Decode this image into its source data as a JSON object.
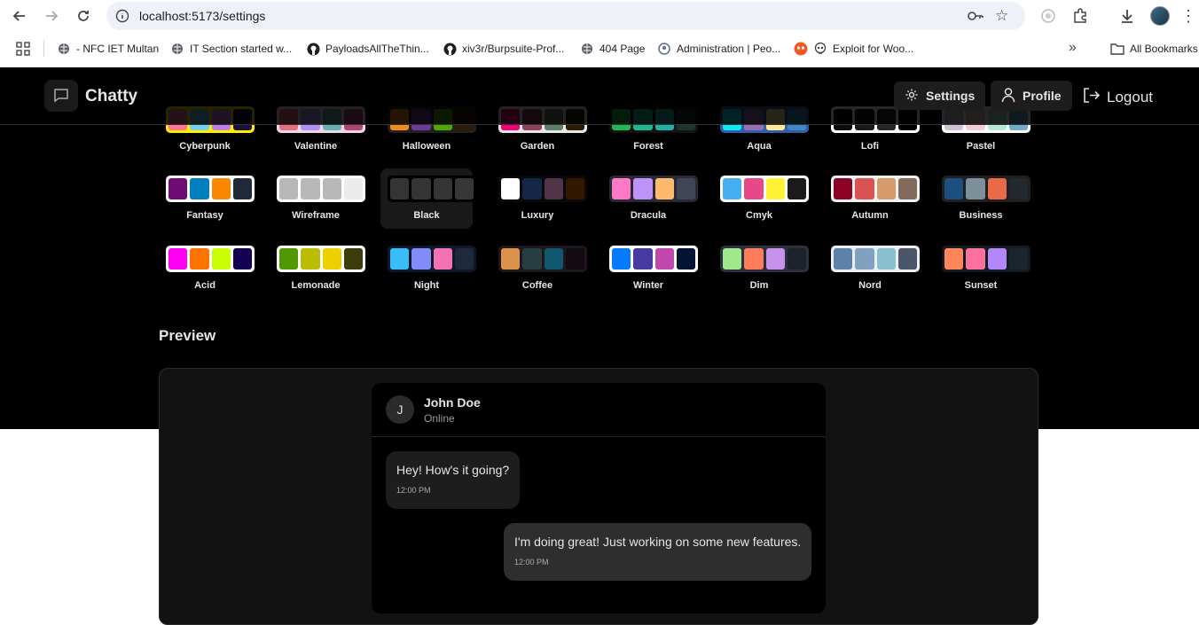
{
  "browser": {
    "url": "localhost:5173/settings",
    "bookmarks": [
      {
        "label": "- NFC IET Multan",
        "icon": "globe-icon"
      },
      {
        "label": "IT Section started w...",
        "icon": "globe-icon"
      },
      {
        "label": "PayloadsAllTheThin...",
        "icon": "github-icon"
      },
      {
        "label": "xiv3r/Burpsuite-Prof...",
        "icon": "github-icon"
      },
      {
        "label": "404 Page",
        "icon": "globe-icon"
      },
      {
        "label": "Administration | Peo...",
        "icon": "people-icon"
      },
      {
        "label": "Exploit for Woo...",
        "icon": "skull-icon"
      }
    ],
    "all_bookmarks": "All Bookmarks",
    "overflow": "»"
  },
  "header": {
    "brand": "Chatty",
    "settings_label": "Settings",
    "profile_label": "Profile",
    "logout_label": "Logout"
  },
  "themes": [
    {
      "name": "Cyberpunk",
      "colors": [
        "#ff7598",
        "#75d1f0",
        "#c07eec",
        "#1a103d"
      ],
      "box": "#ffee00"
    },
    {
      "name": "Valentine",
      "colors": [
        "#e96d7b",
        "#a991f7",
        "#66b1b3",
        "#af4670"
      ],
      "box": "#f0d6e8"
    },
    {
      "name": "Halloween",
      "colors": [
        "#f28c18",
        "#6d3a9c",
        "#51a800",
        "#2f1b05"
      ],
      "box": "#212121"
    },
    {
      "name": "Garden",
      "colors": [
        "#f40076",
        "#8e4162",
        "#5c7f67",
        "#291e00"
      ],
      "box": "#e9e7e7"
    },
    {
      "name": "Forest",
      "colors": [
        "#1eb854",
        "#1db990",
        "#1fb2a6",
        "#19362d"
      ],
      "box": "#171212"
    },
    {
      "name": "Aqua",
      "colors": [
        "#09ecf3",
        "#966fb3",
        "#ffe999",
        "#3b8ac4"
      ],
      "box": "#345da7"
    },
    {
      "name": "Lofi",
      "colors": [
        "#0d0d0d",
        "#1a1919",
        "#262626",
        "#000000"
      ],
      "box": "#ffffff"
    },
    {
      "name": "Pastel",
      "colors": [
        "#d1c1d7",
        "#f6cbd1",
        "#b4e9d6",
        "#70acc7"
      ],
      "box": "#ffffff"
    },
    {
      "name": "Fantasy",
      "colors": [
        "#6e0b75",
        "#007ebd",
        "#f88800",
        "#1f2937"
      ],
      "box": "#ffffff"
    },
    {
      "name": "Wireframe",
      "colors": [
        "#b8b8b8",
        "#b8b8b8",
        "#b8b8b8",
        "#ebebeb"
      ],
      "box": "#ffffff"
    },
    {
      "name": "Black",
      "colors": [
        "#343434",
        "#343434",
        "#343434",
        "#373737"
      ],
      "box": "#000000"
    },
    {
      "name": "Luxury",
      "colors": [
        "#ffffff",
        "#152747",
        "#513448",
        "#331800"
      ],
      "box": "#09090b"
    },
    {
      "name": "Dracula",
      "colors": [
        "#ff79c6",
        "#bd93f9",
        "#ffb86c",
        "#414558"
      ],
      "box": "#282a36"
    },
    {
      "name": "Cmyk",
      "colors": [
        "#45aeee",
        "#e8488a",
        "#fff232",
        "#1a1a1a"
      ],
      "box": "#ffffff"
    },
    {
      "name": "Autumn",
      "colors": [
        "#8c0327",
        "#d85251",
        "#d59b6a",
        "#826a5c"
      ],
      "box": "#f1f1f1"
    },
    {
      "name": "Business",
      "colors": [
        "#1c4e80",
        "#7c909a",
        "#ea6947",
        "#23282e"
      ],
      "box": "#202020"
    },
    {
      "name": "Acid",
      "colors": [
        "#ff00f4",
        "#ff7400",
        "#cbfd03",
        "#140152"
      ],
      "box": "#ffffff"
    },
    {
      "name": "Lemonade",
      "colors": [
        "#519903",
        "#bcbc02",
        "#edd000",
        "#3d3c0c"
      ],
      "box": "#ffffff"
    },
    {
      "name": "Night",
      "colors": [
        "#38bdf8",
        "#818cf8",
        "#f471b5",
        "#1e293b"
      ],
      "box": "#0f172a"
    },
    {
      "name": "Coffee",
      "colors": [
        "#db924b",
        "#263e3f",
        "#10576d",
        "#120c12"
      ],
      "box": "#20161f"
    },
    {
      "name": "Winter",
      "colors": [
        "#047aff",
        "#463aa2",
        "#c148ac",
        "#021431"
      ],
      "box": "#ffffff"
    },
    {
      "name": "Dim",
      "colors": [
        "#9fe88d",
        "#ff7d5c",
        "#c792e9",
        "#1c212b"
      ],
      "box": "#2a303c"
    },
    {
      "name": "Nord",
      "colors": [
        "#5e81ac",
        "#81a1c1",
        "#88c0d0",
        "#4c566a"
      ],
      "box": "#eceff4"
    },
    {
      "name": "Sunset",
      "colors": [
        "#ff865b",
        "#fd6f9c",
        "#b387fa",
        "#1b262c"
      ],
      "box": "#121c22"
    }
  ],
  "preview": {
    "heading": "Preview",
    "contact_initial": "J",
    "contact_name": "John Doe",
    "contact_status": "Online",
    "messages": [
      {
        "text": "Hey! How's it going?",
        "time": "12:00 PM",
        "own": false
      },
      {
        "text": "I'm doing great! Just working on some new features.",
        "time": "12:00 PM",
        "own": true
      }
    ]
  }
}
